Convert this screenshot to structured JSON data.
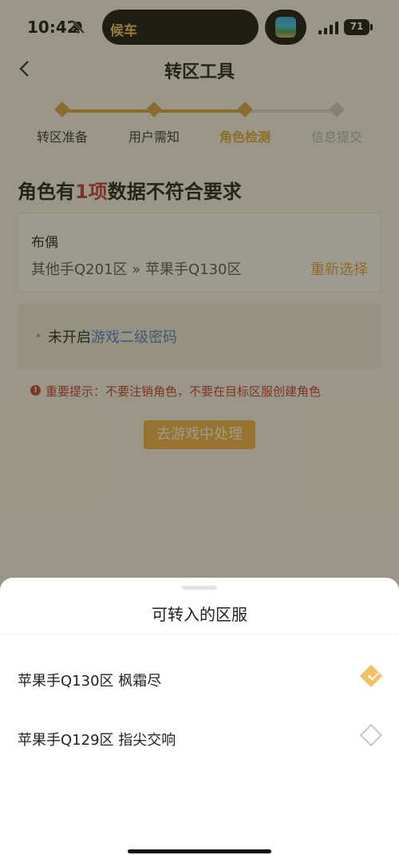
{
  "status_bar": {
    "time": "10:42",
    "island_text": "候车",
    "battery": "71"
  },
  "nav": {
    "title": "转区工具"
  },
  "steps": [
    {
      "label": "转区准备",
      "state": "done"
    },
    {
      "label": "用户需知",
      "state": "done"
    },
    {
      "label": "角色检测",
      "state": "current"
    },
    {
      "label": "信息提交",
      "state": "pending"
    }
  ],
  "headline": {
    "prefix": "角色有",
    "count": "1项",
    "suffix": "数据不符合要求"
  },
  "role_card": {
    "role": "布偶",
    "route": "其他手Q201区 » 苹果手Q130区",
    "reselect": "重新选择"
  },
  "issue": {
    "prefix": "未开启",
    "link": "游戏二级密码"
  },
  "warning": {
    "icon": "!",
    "text": "重要提示：不要注销角色，不要在目标区服创建角色"
  },
  "cta": "去游戏中处理",
  "sheet": {
    "title": "可转入的区服",
    "options": [
      {
        "label": "苹果手Q130区 枫霜尽",
        "selected": true
      },
      {
        "label": "苹果手Q129区 指尖交响",
        "selected": false
      }
    ]
  },
  "colors": {
    "accent": "#e0a53e",
    "danger": "#c23b3b",
    "link": "#4a7fd0"
  }
}
